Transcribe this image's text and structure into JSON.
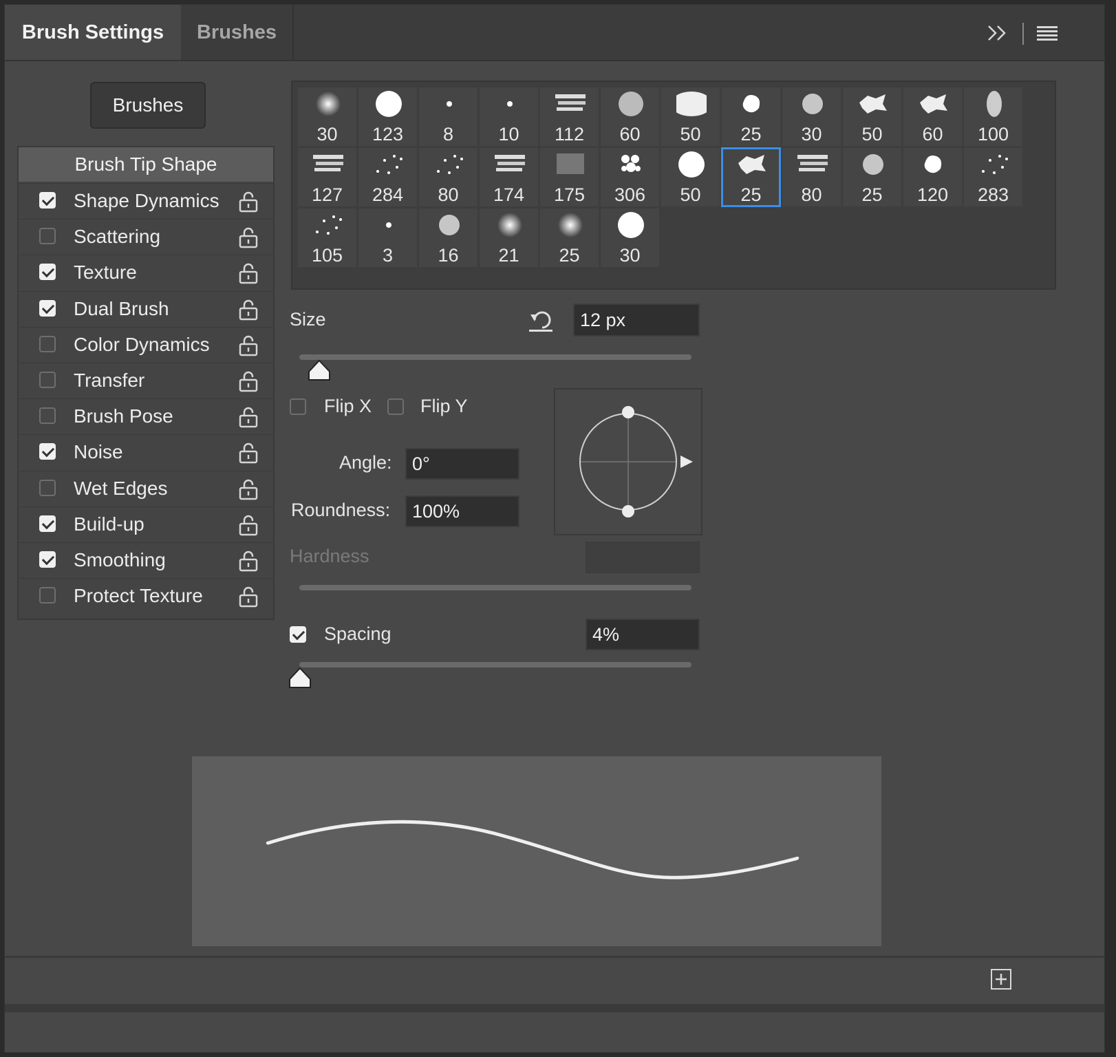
{
  "tabs": {
    "brush_settings": "Brush Settings",
    "brushes": "Brushes"
  },
  "toolbar_icons": {
    "expand": "double-chevron-right-icon",
    "menu": "hamburger-menu-icon"
  },
  "brushes_button": "Brushes",
  "sidebar": {
    "header": "Brush Tip Shape",
    "items": [
      {
        "label": "Shape Dynamics",
        "checked": true
      },
      {
        "label": "Scattering",
        "checked": false
      },
      {
        "label": "Texture",
        "checked": true
      },
      {
        "label": "Dual Brush",
        "checked": true
      },
      {
        "label": "Color Dynamics",
        "checked": false
      },
      {
        "label": "Transfer",
        "checked": false
      },
      {
        "label": "Brush Pose",
        "checked": false
      },
      {
        "label": "Noise",
        "checked": true
      },
      {
        "label": "Wet Edges",
        "checked": false
      },
      {
        "label": "Build-up",
        "checked": true
      },
      {
        "label": "Smoothing",
        "checked": true
      },
      {
        "label": "Protect Texture",
        "checked": false
      }
    ]
  },
  "presets": {
    "sizes": [
      "30",
      "123",
      "8",
      "10",
      "112",
      "60",
      "50",
      "25",
      "30",
      "50",
      "60",
      "100",
      "127",
      "284",
      "80",
      "174",
      "175",
      "306",
      "50",
      "25",
      "80",
      "25",
      "120",
      "283",
      "105",
      "3",
      "16",
      "21",
      "25",
      "30"
    ],
    "selected_index": 19
  },
  "size": {
    "label": "Size",
    "value": "12 px",
    "slider_fraction": 0.05
  },
  "flip": {
    "x_label": "Flip X",
    "y_label": "Flip Y",
    "x_checked": false,
    "y_checked": false
  },
  "angle": {
    "label": "Angle:",
    "value": "0°"
  },
  "roundness": {
    "label": "Roundness:",
    "value": "100%"
  },
  "hardness": {
    "label": "Hardness",
    "value": ""
  },
  "spacing": {
    "label": "Spacing",
    "value": "4%",
    "checked": true,
    "slider_fraction": 0.0
  },
  "footer": {
    "new_icon": "new-preset-icon"
  },
  "colors": {
    "accent": "#3a8fe8",
    "panel": "#484848",
    "field": "#2f2f2f"
  }
}
